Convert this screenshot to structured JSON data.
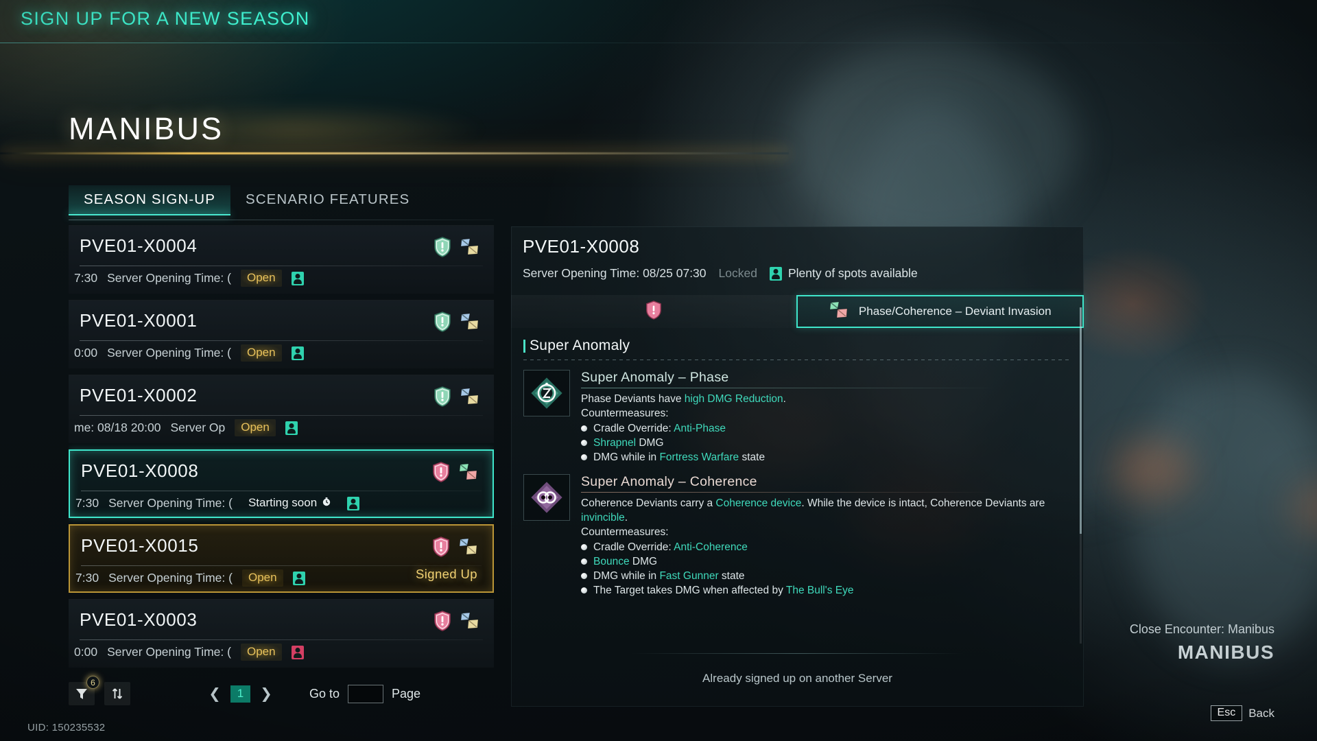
{
  "header": {
    "title": "SIGN UP FOR A NEW SEASON"
  },
  "season": {
    "title": "MANIBUS"
  },
  "tabs": [
    {
      "label": "SEASON SIGN-UP",
      "active": true
    },
    {
      "label": "SCENARIO FEATURES",
      "active": false
    }
  ],
  "server_list": [
    {
      "name": "PVE01-X0004",
      "meta_left": "7:30",
      "meta_mid": "Server Opening Time: (",
      "status": "Open",
      "status_kind": "open",
      "capacity": "available",
      "shield": "green",
      "flags": "blue-yellow",
      "state": "normal"
    },
    {
      "name": "PVE01-X0001",
      "meta_left": "0:00",
      "meta_mid": "Server Opening Time: (",
      "status": "Open",
      "status_kind": "open",
      "capacity": "available",
      "shield": "green",
      "flags": "blue-yellow",
      "state": "normal"
    },
    {
      "name": "PVE01-X0002",
      "meta_left": "me: 08/18 20:00",
      "meta_mid": "Server Op",
      "status": "Open",
      "status_kind": "open",
      "capacity": "available",
      "shield": "green",
      "flags": "blue-yellow",
      "state": "normal"
    },
    {
      "name": "PVE01-X0008",
      "meta_left": "7:30",
      "meta_mid": "Server Opening Time: (",
      "status": "Starting soon",
      "status_kind": "soon",
      "capacity": "available",
      "shield": "pink",
      "flags": "green-pink",
      "state": "selected"
    },
    {
      "name": "PVE01-X0015",
      "meta_left": "7:30",
      "meta_mid": "Server Opening Time: (",
      "status": "Open",
      "status_kind": "open",
      "capacity": "available",
      "shield": "pink",
      "flags": "blue-yellow",
      "state": "signed",
      "signed_label": "Signed Up"
    },
    {
      "name": "PVE01-X0003",
      "meta_left": "0:00",
      "meta_mid": "Server Opening Time: (",
      "status": "Open",
      "status_kind": "open",
      "capacity": "full",
      "shield": "pink",
      "flags": "blue-yellow",
      "state": "normal"
    }
  ],
  "pagination": {
    "filter_icon": "filter-icon",
    "filter_badge": "6",
    "sort_icon": "sort-icon",
    "prev": "❮",
    "page": "1",
    "next": "❯",
    "goto_label": "Go to",
    "goto_value": "",
    "page_label": "Page"
  },
  "uid": "UID: 150235532",
  "detail": {
    "name": "PVE01-X0008",
    "opening_time": "Server Opening Time: 08/25 07:30",
    "locked": "Locked",
    "spots": "Plenty of spots available",
    "mode_tabs": [
      {
        "label": "",
        "icon": "pink-shield-icon",
        "active": false
      },
      {
        "label": "Phase/Coherence – Deviant Invasion",
        "icon": "green-pink-flags-icon",
        "active": true
      }
    ],
    "section_title": "Super Anomaly",
    "anomalies": [
      {
        "title": "Super Anomaly – Phase",
        "icon": "phase-diamond-icon",
        "desc_parts": [
          {
            "t": "Phase Deviants have ",
            "hl": false
          },
          {
            "t": "high DMG Reduction",
            "hl": true
          },
          {
            "t": ".",
            "hl": false
          }
        ],
        "countermeasures_label": "Countermeasures:",
        "countermeasures": [
          [
            {
              "t": "Cradle Override: ",
              "hl": false
            },
            {
              "t": "Anti-Phase",
              "hl": true
            }
          ],
          [
            {
              "t": "Shrapnel",
              "hl": true
            },
            {
              "t": " DMG",
              "hl": false
            }
          ],
          [
            {
              "t": "DMG while in ",
              "hl": false
            },
            {
              "t": "Fortress Warfare",
              "hl": true
            },
            {
              "t": " state",
              "hl": false
            }
          ]
        ]
      },
      {
        "title": "Super Anomaly – Coherence",
        "icon": "coherence-diamond-icon",
        "desc_parts": [
          {
            "t": "Coherence Deviants carry a ",
            "hl": false
          },
          {
            "t": "Coherence device",
            "hl": true
          },
          {
            "t": ". While the device is intact, Coherence Deviants are ",
            "hl": false
          },
          {
            "t": "invincible",
            "hl": true
          },
          {
            "t": ".",
            "hl": false
          }
        ],
        "countermeasures_label": "Countermeasures:",
        "countermeasures": [
          [
            {
              "t": "Cradle Override: ",
              "hl": false
            },
            {
              "t": "Anti-Coherence",
              "hl": true
            }
          ],
          [
            {
              "t": "Bounce",
              "hl": true
            },
            {
              "t": " DMG",
              "hl": false
            }
          ],
          [
            {
              "t": "DMG while in ",
              "hl": false
            },
            {
              "t": "Fast Gunner",
              "hl": true
            },
            {
              "t": " state",
              "hl": false
            }
          ],
          [
            {
              "t": "The Target takes DMG when affected by ",
              "hl": false
            },
            {
              "t": "The Bull's Eye",
              "hl": true
            }
          ]
        ]
      }
    ],
    "footer_text": "Already signed up on another Server"
  },
  "encounter": {
    "subtitle": "Close Encounter: Manibus",
    "title": "MANIBUS"
  },
  "back": {
    "key": "Esc",
    "label": "Back"
  },
  "colors": {
    "accent_teal": "#3fe6cb",
    "header_teal": "#3ff0cf",
    "open_gold": "#e7c15c",
    "signed_gold": "#f0d173",
    "shield_green": "#8fd6b6",
    "shield_pink": "#e87f9e",
    "highlight": "#3fd9bb"
  }
}
